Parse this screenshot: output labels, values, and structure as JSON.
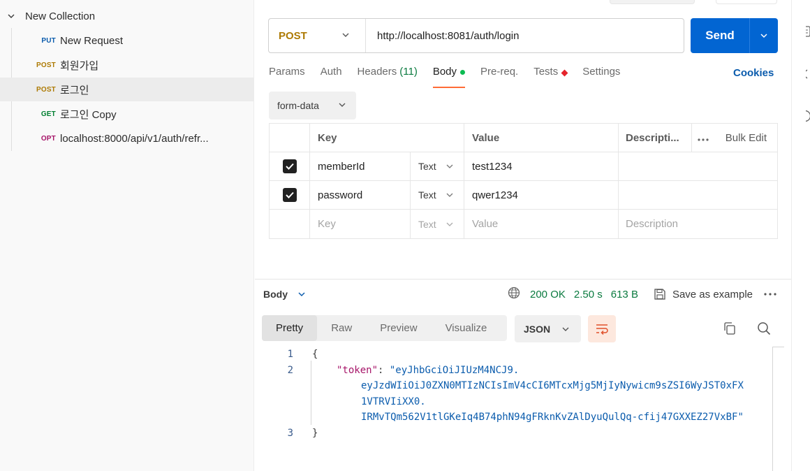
{
  "sidebar": {
    "collection_name": "New Collection",
    "requests": [
      {
        "method": "PUT",
        "name": "New Request"
      },
      {
        "method": "POST",
        "name": "회원가입"
      },
      {
        "method": "POST",
        "name": "로그인"
      },
      {
        "method": "GET",
        "name": "로그인 Copy"
      },
      {
        "method": "OPT",
        "name": "localhost:8000/api/v1/auth/refr..."
      }
    ]
  },
  "request": {
    "method": "POST",
    "url": "http://localhost:8081/auth/login",
    "send_label": "Send",
    "tabs": {
      "params": "Params",
      "auth": "Auth",
      "headers": "Headers",
      "headers_count": "(11)",
      "body": "Body",
      "prereq": "Pre-req.",
      "tests": "Tests",
      "settings": "Settings"
    },
    "cookies_label": "Cookies",
    "body_mode": "form-data",
    "table": {
      "headers": {
        "key": "Key",
        "value": "Value",
        "description": "Descripti...",
        "bulk_edit": "Bulk Edit"
      },
      "rows": [
        {
          "key": "memberId",
          "type": "Text",
          "value": "test1234",
          "checked": true
        },
        {
          "key": "password",
          "type": "Text",
          "value": "qwer1234",
          "checked": true
        }
      ],
      "placeholder": {
        "key": "Key",
        "type": "Text",
        "value": "Value",
        "description": "Description"
      }
    }
  },
  "response": {
    "body_label": "Body",
    "status": "200 OK",
    "time": "2.50 s",
    "size": "613 B",
    "save_label": "Save as example",
    "view_tabs": [
      "Pretty",
      "Raw",
      "Preview",
      "Visualize"
    ],
    "format": "JSON",
    "code": {
      "line_numbers": [
        "1",
        "2",
        "3"
      ],
      "open_brace": "{",
      "close_brace": "}",
      "key": "\"token\"",
      "colon": ": ",
      "value_lines": [
        "\"eyJhbGciOiJIUzM4NCJ9.",
        "eyJzdWIiOiJ0ZXN0MTIzNCIsImV4cCI6MTcxMjg5MjIyNywicm9sZSI6WyJST0xFX",
        "1VTRVIiXX0.",
        "IRMvTQm562V1tlGKeIq4B74phN94gFRknKvZAlDyuQulQq-cfij47GXXEZ27VxBF\""
      ]
    }
  },
  "colors": {
    "accent": "#ff6c37",
    "send": "#0265d2",
    "post": "#ad7a03",
    "get": "#007f31",
    "put": "#0b5cad",
    "opt": "#a61468",
    "status_ok": "#0a7a3f"
  }
}
